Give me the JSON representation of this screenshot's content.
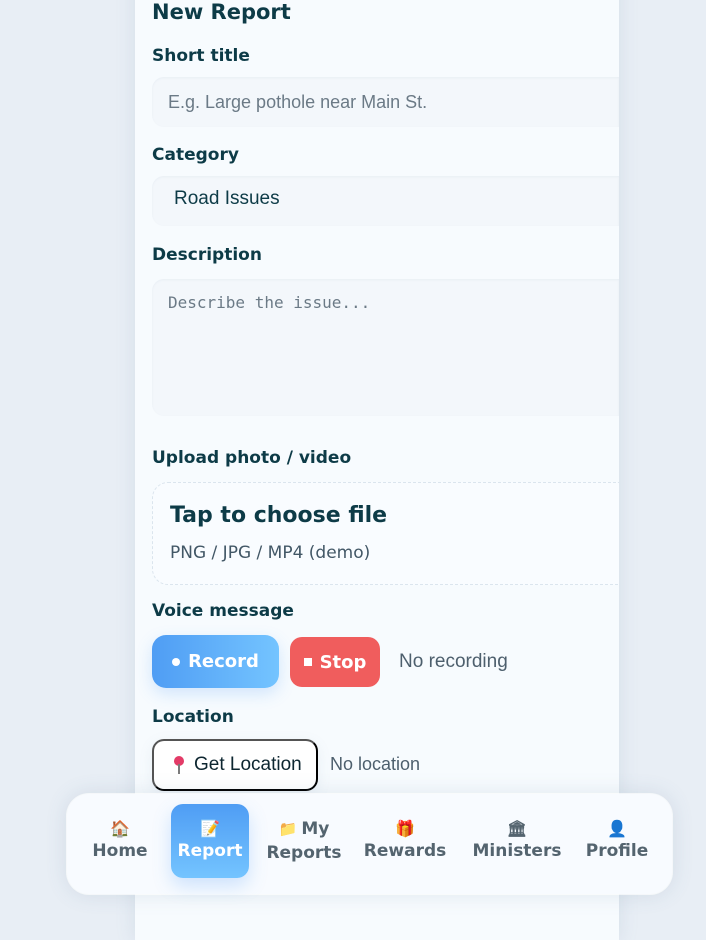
{
  "page": {
    "title": "New Report"
  },
  "form": {
    "short_title": {
      "label": "Short title",
      "placeholder": "E.g. Large pothole near Main St.",
      "value": ""
    },
    "category": {
      "label": "Category",
      "selected": "Road Issues"
    },
    "description": {
      "label": "Description",
      "placeholder": "Describe the issue...",
      "value": ""
    },
    "upload": {
      "label": "Upload photo / video",
      "title": "Tap to choose file",
      "subtitle": "PNG / JPG / MP4 (demo)"
    },
    "voice": {
      "label": "Voice message",
      "record_label": "Record",
      "stop_label": "Stop",
      "status": "No recording"
    },
    "location": {
      "label": "Location",
      "button_label": "Get Location",
      "status": "No location",
      "icon": "map-pin-icon"
    }
  },
  "bottom_nav": {
    "items": [
      {
        "label": "Home",
        "icon": "🏠",
        "icon_name": "home-icon",
        "active": false
      },
      {
        "label": "Report",
        "icon": "📝",
        "icon_name": "report-icon",
        "active": true
      },
      {
        "label_line1": "My",
        "label_line2": "Reports",
        "icon": "📁",
        "icon_name": "folder-icon",
        "active": false
      },
      {
        "label": "Rewards",
        "icon": "🎁",
        "icon_name": "gift-icon",
        "active": false
      },
      {
        "label": "Ministers",
        "icon": "🏛",
        "icon_name": "government-icon",
        "active": false
      },
      {
        "label": "Profile",
        "icon": "👤",
        "icon_name": "user-icon",
        "active": false
      }
    ]
  },
  "colors": {
    "primary": "#4f9df4",
    "primary_light": "#74c4ff",
    "danger": "#f05d5d",
    "text_dark": "#0d3b47",
    "text_muted": "#4d5f6d",
    "page_bg": "#e8eef5",
    "card_bg": "#f7fbfe"
  }
}
